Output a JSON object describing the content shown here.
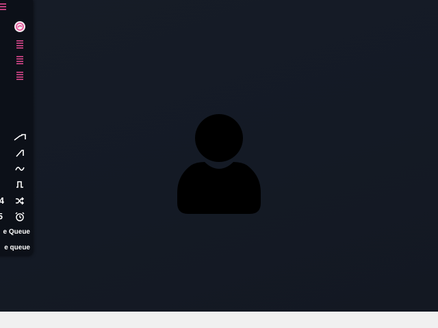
{
  "sidebar": {
    "menu_icon": "hamburger-menu-icon",
    "logo_icon": "app-logo-icon",
    "lists": [
      "list-icon",
      "list-icon",
      "list-icon"
    ],
    "waveforms": [
      "sawtooth-wave-icon",
      "ramp-wave-icon",
      "sine-wave-icon",
      "square-wave-icon",
      "shuffle-icon",
      "alarm-clock-icon"
    ],
    "counter_1": "4",
    "counter_2": "5",
    "queue_label_1": "e Queue",
    "queue_label_2": "e queue"
  },
  "main": {
    "placeholder_icon": "user-avatar-icon"
  },
  "colors": {
    "accent": "#e84a95",
    "background": "#151b26",
    "sidebar": "#0c1018",
    "bottom_bar": "#f0f0f0"
  }
}
